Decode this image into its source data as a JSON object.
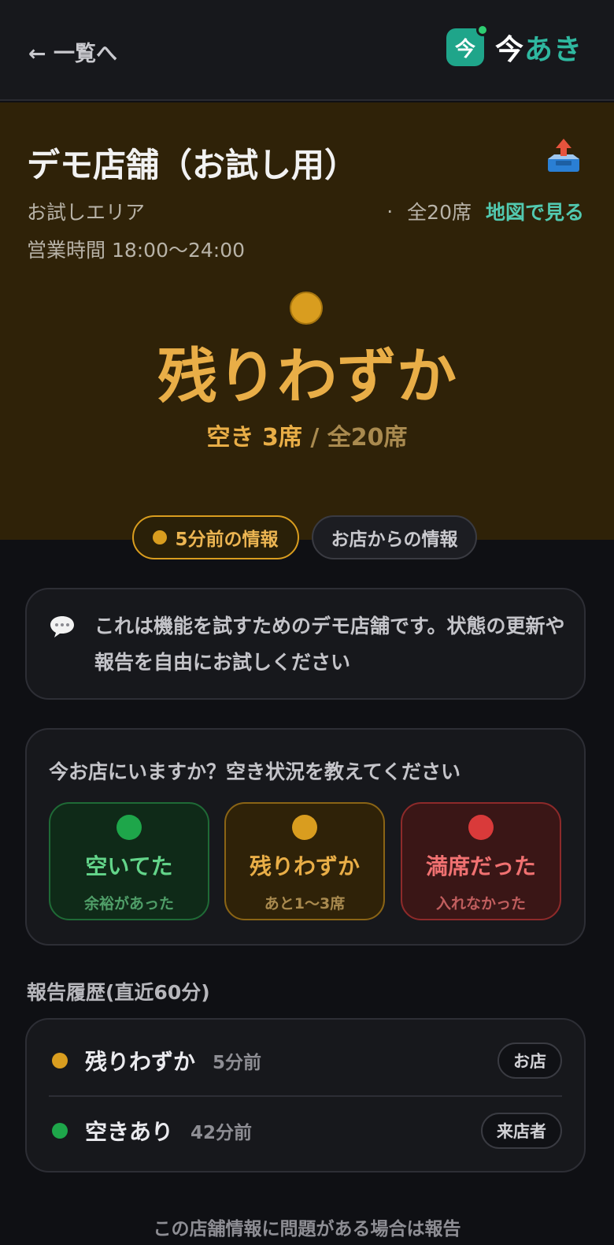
{
  "header": {
    "back_label": "← 一覧へ",
    "brand_icon_char": "今",
    "brand_part1": "今",
    "brand_part2": "あき"
  },
  "shop": {
    "name": "デモ店舗（お試し用）",
    "area": "お試しエリア",
    "separator": "·",
    "seats_total": "全20席",
    "map_link": "地図で見る",
    "hours": "営業時間 18:00〜24:00"
  },
  "status": {
    "label": "残りわずか",
    "free_seats": "空き 3席",
    "total_seats": "/ 全20席",
    "color": "#d99d1f"
  },
  "tags": {
    "time": "5分前の情報",
    "source": "お店からの情報"
  },
  "note": {
    "text": "これは機能を試すためのデモ店舗です。状態の更新や報告を自由にお試しください"
  },
  "report": {
    "question": "今お店にいますか？空き状況を教えてください",
    "options": [
      {
        "label": "空いてた",
        "sub": "余裕があった",
        "color": "#1ea64a"
      },
      {
        "label": "残りわずか",
        "sub": "あと1〜3席",
        "color": "#d99d1f"
      },
      {
        "label": "満席だった",
        "sub": "入れなかった",
        "color": "#d93a3a"
      }
    ]
  },
  "history": {
    "heading": "報告履歴(直近60分)",
    "rows": [
      {
        "label": "残りわずか",
        "time": "5分前",
        "badge": "お店",
        "color": "#d99d1f"
      },
      {
        "label": "空きあり",
        "time": "42分前",
        "badge": "来店者",
        "color": "#1ea64a"
      }
    ]
  },
  "footer": {
    "report_issue": "この店舗情報に問題がある場合は報告"
  }
}
